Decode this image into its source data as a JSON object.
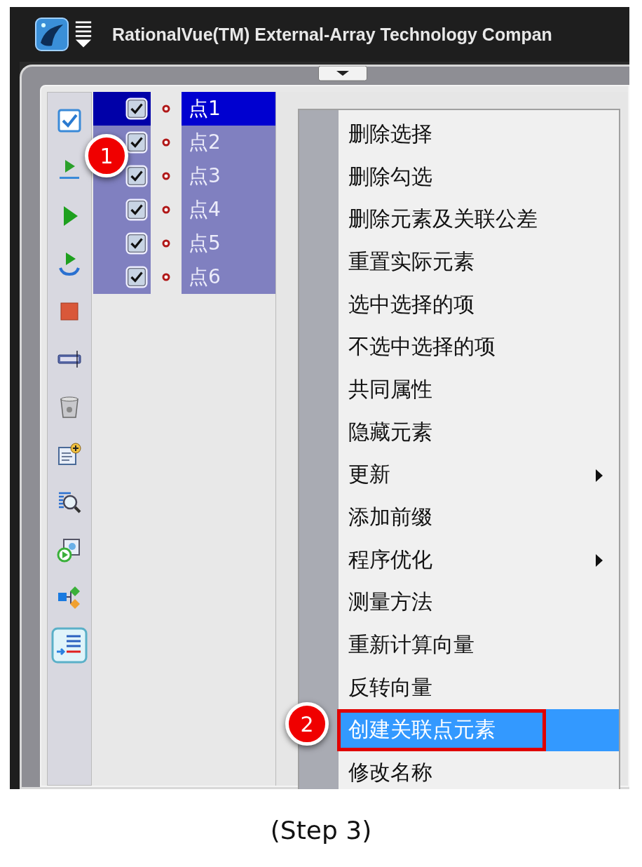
{
  "window": {
    "title": "RationalVue(TM) External-Array Technology Compan"
  },
  "points": [
    {
      "label": "点1",
      "checked": true,
      "selected": true,
      "focused": true
    },
    {
      "label": "点2",
      "checked": true,
      "selected": true,
      "focused": false
    },
    {
      "label": "点3",
      "checked": true,
      "selected": true,
      "focused": false
    },
    {
      "label": "点4",
      "checked": true,
      "selected": true,
      "focused": false
    },
    {
      "label": "点5",
      "checked": true,
      "selected": true,
      "focused": false
    },
    {
      "label": "点6",
      "checked": true,
      "selected": true,
      "focused": false
    }
  ],
  "context_menu": {
    "items": [
      {
        "label": "删除选择",
        "has_submenu": false,
        "selected": false,
        "annotated": false
      },
      {
        "label": "删除勾选",
        "has_submenu": false,
        "selected": false,
        "annotated": false
      },
      {
        "label": "删除元素及关联公差",
        "has_submenu": false,
        "selected": false,
        "annotated": false
      },
      {
        "label": "重置实际元素",
        "has_submenu": false,
        "selected": false,
        "annotated": false
      },
      {
        "label": "选中选择的项",
        "has_submenu": false,
        "selected": false,
        "annotated": false
      },
      {
        "label": "不选中选择的项",
        "has_submenu": false,
        "selected": false,
        "annotated": false
      },
      {
        "label": "共同属性",
        "has_submenu": false,
        "selected": false,
        "annotated": false
      },
      {
        "label": "隐藏元素",
        "has_submenu": false,
        "selected": false,
        "annotated": false
      },
      {
        "label": "更新",
        "has_submenu": true,
        "selected": false,
        "annotated": false
      },
      {
        "label": "添加前缀",
        "has_submenu": false,
        "selected": false,
        "annotated": false
      },
      {
        "label": "程序优化",
        "has_submenu": true,
        "selected": false,
        "annotated": false
      },
      {
        "label": "测量方法",
        "has_submenu": false,
        "selected": false,
        "annotated": false
      },
      {
        "label": "重新计算向量",
        "has_submenu": false,
        "selected": false,
        "annotated": false
      },
      {
        "label": "反转向量",
        "has_submenu": false,
        "selected": false,
        "annotated": false
      },
      {
        "label": "创建关联点元素",
        "has_submenu": false,
        "selected": true,
        "annotated": true
      },
      {
        "label": "修改名称",
        "has_submenu": false,
        "selected": false,
        "annotated": false
      }
    ]
  },
  "callouts": [
    "1",
    "2"
  ],
  "caption": "(Step 3)"
}
